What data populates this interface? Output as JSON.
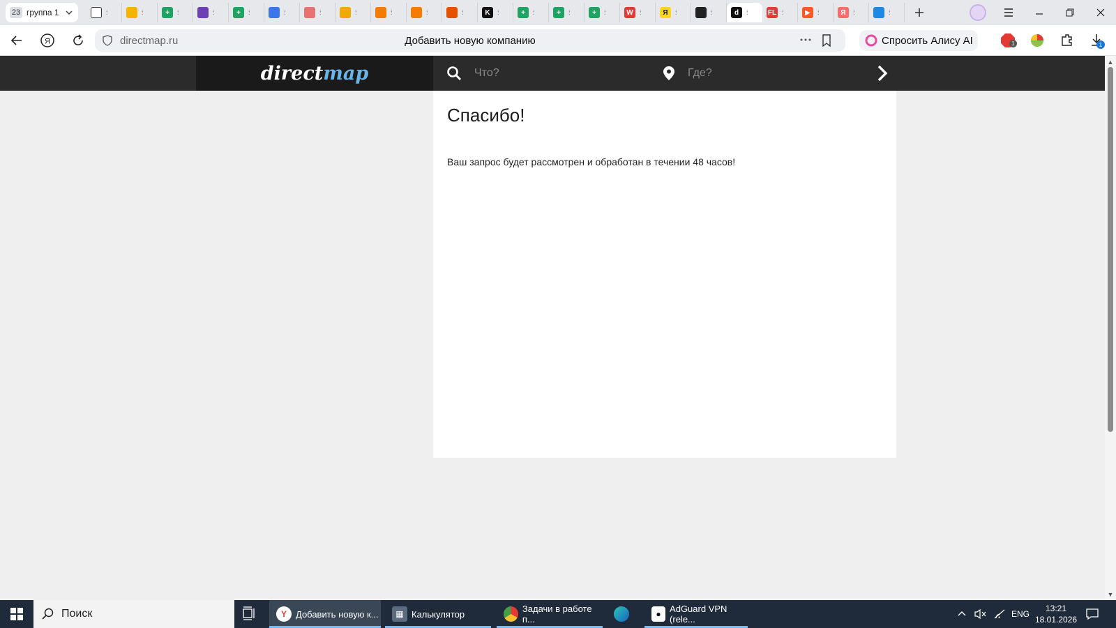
{
  "browser": {
    "tab_group": {
      "count": "23",
      "name": "группа 1"
    },
    "tabs": [
      {
        "icon": "document-icon",
        "glyph": "",
        "color": "#ffffff"
      },
      {
        "icon": "google-drive-icon",
        "glyph": "",
        "color": "#f4b400"
      },
      {
        "icon": "sheets-icon",
        "glyph": "+",
        "color": "#1ea362"
      },
      {
        "icon": "purple-circle-icon",
        "glyph": "",
        "color": "#6c3fb3"
      },
      {
        "icon": "sheets-icon",
        "glyph": "+",
        "color": "#1ea362"
      },
      {
        "icon": "heart-icon",
        "glyph": "",
        "color": "#3b78e7"
      },
      {
        "icon": "target-icon",
        "glyph": "",
        "color": "#e57373"
      },
      {
        "icon": "chat-icon",
        "glyph": "",
        "color": "#f2a900"
      },
      {
        "icon": "envelope-icon",
        "glyph": "",
        "color": "#f57c00"
      },
      {
        "icon": "envelope-icon",
        "glyph": "",
        "color": "#f57c00"
      },
      {
        "icon": "flame-icon",
        "glyph": "",
        "color": "#e65100"
      },
      {
        "icon": "k-logo-icon",
        "glyph": "K",
        "color": "#111111"
      },
      {
        "icon": "sheets-icon",
        "glyph": "+",
        "color": "#1ea362"
      },
      {
        "icon": "sheets-icon",
        "glyph": "+",
        "color": "#1ea362"
      },
      {
        "icon": "sheets-icon",
        "glyph": "+",
        "color": "#1ea362"
      },
      {
        "icon": "w-logo-icon",
        "glyph": "W",
        "color": "#e53935"
      },
      {
        "icon": "ya-market-icon",
        "glyph": "Я",
        "color": "#f9d71c"
      },
      {
        "icon": "spinner-icon",
        "glyph": "",
        "color": "#222222"
      },
      {
        "icon": "directmap-favicon-icon",
        "glyph": "d",
        "color": "#111111",
        "active": true
      },
      {
        "icon": "fl-logo-icon",
        "glyph": "FL",
        "color": "#e53935"
      },
      {
        "icon": "play-icon",
        "glyph": "▶",
        "color": "#ff5722"
      },
      {
        "icon": "yandex-icon",
        "glyph": "Я",
        "color": "#ff6b6b"
      },
      {
        "icon": "message-icon",
        "glyph": "",
        "color": "#1e88e5"
      }
    ],
    "address": {
      "url": "directmap.ru",
      "page_title": "Добавить новую компанию"
    },
    "alice_label": "Спросить Алису AI",
    "extension_badges": {
      "adblock": "1",
      "downloads": "1"
    }
  },
  "site": {
    "logo": {
      "part1": "direct",
      "part2": "map"
    },
    "search_what_placeholder": "Что?",
    "search_where_placeholder": "Где?"
  },
  "content": {
    "heading": "Спасибо!",
    "message": "Ваш запрос будет рассмотрен и обработан в течении 48 часов!"
  },
  "taskbar": {
    "search_placeholder": "Поиск",
    "apps": [
      {
        "label": "Добавить новую к...",
        "icon": "yandex-browser-icon"
      },
      {
        "label": "Калькулятор",
        "icon": "calculator-icon"
      },
      {
        "label": "Задачи в работе п...",
        "icon": "chrome-icon"
      },
      {
        "label": "",
        "icon": "edge-icon"
      },
      {
        "label": "AdGuard VPN (rele...",
        "icon": "adguard-vpn-icon"
      }
    ],
    "language": "ENG",
    "time": "13:21",
    "date": "18.01.2026"
  }
}
